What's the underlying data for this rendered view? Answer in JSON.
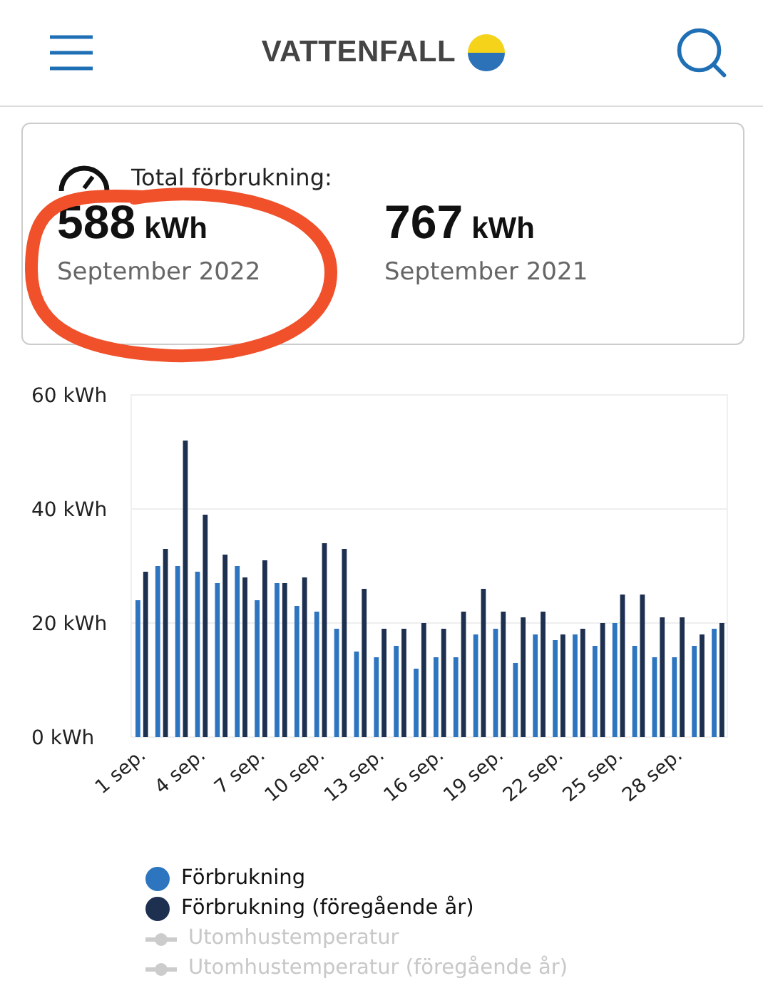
{
  "header": {
    "logo_text": "VATTENFALL"
  },
  "summary": {
    "title": "Total förbrukning:",
    "items": [
      {
        "value": "588",
        "unit": "kWh",
        "period": "September 2022",
        "circled": true
      },
      {
        "value": "767",
        "unit": "kWh",
        "period": "September 2021",
        "circled": false
      }
    ]
  },
  "chart": {
    "chart_data": {
      "type": "bar",
      "categories": [
        "1 sep.",
        null,
        null,
        "4 sep.",
        null,
        null,
        "7 sep.",
        null,
        null,
        "10 sep.",
        null,
        null,
        "13 sep.",
        null,
        null,
        "16 sep.",
        null,
        null,
        "19 sep.",
        null,
        null,
        "22 sep.",
        null,
        null,
        "25 sep.",
        null,
        null,
        "28 sep.",
        null,
        null
      ],
      "yticks": [
        {
          "value": 0,
          "label": "0 kWh"
        },
        {
          "value": 20,
          "label": "20 kWh"
        },
        {
          "value": 40,
          "label": "40 kWh"
        },
        {
          "value": 60,
          "label": "60 kWh"
        }
      ],
      "ylim": [
        0,
        60
      ],
      "series": [
        {
          "name": "Förbrukning",
          "color": "#2e75c0",
          "values": [
            24,
            30,
            30,
            29,
            27,
            30,
            24,
            27,
            23,
            22,
            19,
            15,
            14,
            16,
            12,
            14,
            14,
            18,
            19,
            13,
            18,
            17,
            18,
            16,
            20,
            16,
            14,
            14,
            16,
            19
          ]
        },
        {
          "name": "Förbrukning (föregående år)",
          "color": "#1e3050",
          "values": [
            29,
            33,
            52,
            39,
            32,
            28,
            31,
            27,
            28,
            34,
            33,
            26,
            19,
            19,
            20,
            19,
            22,
            26,
            22,
            21,
            22,
            18,
            19,
            20,
            25,
            25,
            21,
            21,
            18,
            20
          ]
        }
      ]
    }
  },
  "legend": [
    {
      "label": "Utomhustemperatur",
      "kind": "line",
      "color": "#cccccc",
      "disabled": true
    },
    {
      "label": "Utomhustemperatur (föregående år)",
      "kind": "line",
      "color": "#cccccc",
      "disabled": true
    }
  ]
}
